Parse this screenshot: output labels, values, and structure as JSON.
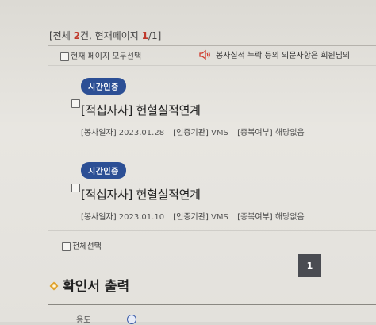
{
  "summary": {
    "prefix": "[전체 ",
    "total": "2",
    "middle": "건, 현재페이지 ",
    "page": "1",
    "suffix": "/1]"
  },
  "toolbar": {
    "select_page_label": "현재 페이지 모두선택",
    "notice_text": "봉사실적 누락 등의 의문사항은 회원님의"
  },
  "items": [
    {
      "badge": "시간인증",
      "title": "[적십자사] 헌혈실적연계",
      "date_label": "[봉사일자]",
      "date_value": "2023.01.28",
      "agency_label": "[인증기관]",
      "agency_value": "VMS",
      "dup_label": "[중복여부]",
      "dup_value": "해당없음"
    },
    {
      "badge": "시간인증",
      "title": "[적십자사] 헌혈실적연계",
      "date_label": "[봉사일자]",
      "date_value": "2023.01.10",
      "agency_label": "[인증기관]",
      "agency_value": "VMS",
      "dup_label": "[중복여부]",
      "dup_value": "해당없음"
    }
  ],
  "bottom": {
    "select_all_label": "전체선택",
    "page_number": "1"
  },
  "certificate": {
    "title": "확인서 출력",
    "purpose_label": "용도"
  },
  "colors": {
    "badge": "#2c4f95",
    "accent_red": "#c0392b",
    "pager": "#4a4c52"
  }
}
